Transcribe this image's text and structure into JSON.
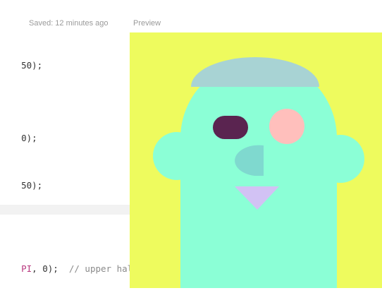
{
  "editor": {
    "saved_status": "Saved: 12 minutes ago",
    "lines": [
      {
        "text": "50);"
      },
      {
        "text": "0);"
      },
      {
        "text": "50);"
      },
      {
        "prefix": "PI",
        "text": ", 0);  ",
        "comment": "// upper half"
      }
    ]
  },
  "preview": {
    "label": "Preview"
  },
  "colors": {
    "background": "#eefb5e",
    "face": "#8bffd6",
    "hat": "#a8d3d4",
    "left_eye": "#5a2450",
    "right_eye": "#ffbfbc",
    "nose": "#7fd9cf",
    "mouth": "#d2c2f4"
  }
}
